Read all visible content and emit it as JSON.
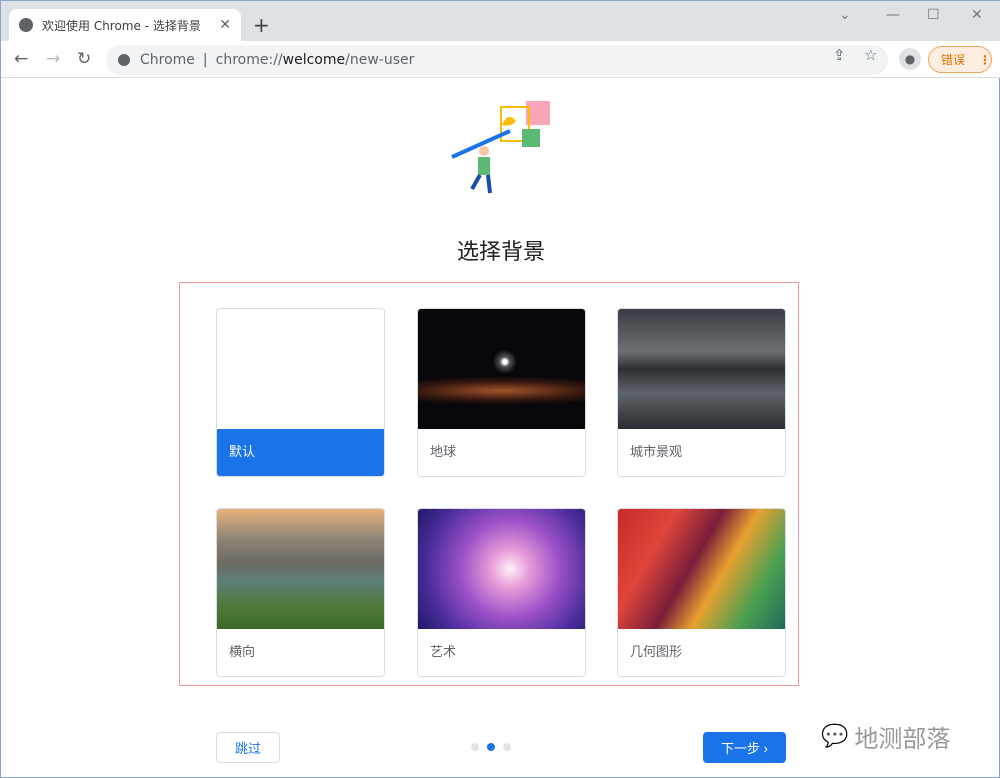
{
  "browser": {
    "tab_title": "欢迎使用 Chrome - 选择背景",
    "omnibox_prefix": "Chrome",
    "url_scheme": "chrome://",
    "url_host": "welcome",
    "url_path": "/new-user",
    "error_label": "错误"
  },
  "page": {
    "title": "选择背景",
    "backgrounds": [
      {
        "label": "默认",
        "selected": true
      },
      {
        "label": "地球"
      },
      {
        "label": "城市景观"
      },
      {
        "label": "横向"
      },
      {
        "label": "艺术"
      },
      {
        "label": "几何图形"
      }
    ],
    "skip_label": "跳过",
    "next_label": "下一步",
    "step_current": 2,
    "step_total": 3
  },
  "watermark": "地测部落",
  "colors": {
    "accent": "#1a73e8",
    "frame": "#f19a9a"
  }
}
